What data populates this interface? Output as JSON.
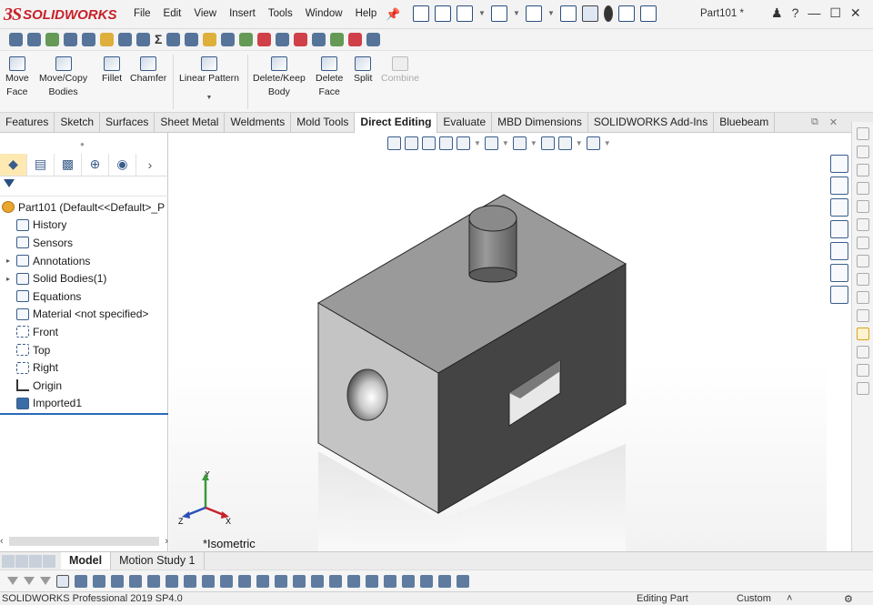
{
  "app": {
    "brand_ds": "3S",
    "brand_name": "SOLIDWORKS",
    "document_title": "Part101 *",
    "brand_color": "#c8202a"
  },
  "menu": [
    "File",
    "Edit",
    "View",
    "Insert",
    "Tools",
    "Window",
    "Help"
  ],
  "window_controls": [
    "person-icon",
    "help-icon",
    "minimize-icon",
    "maximize-icon",
    "close-icon"
  ],
  "command_manager": {
    "buttons": [
      {
        "label": "Move\nFace"
      },
      {
        "label": "Move/Copy\nBodies"
      },
      {
        "label": "Fillet"
      },
      {
        "label": "Chamfer"
      },
      {
        "label": "Linear Pattern"
      },
      {
        "label": "Delete/Keep\nBody"
      },
      {
        "label": "Delete\nFace"
      },
      {
        "label": "Split"
      },
      {
        "label": "Combine",
        "disabled": true
      }
    ]
  },
  "tabs": [
    "Features",
    "Sketch",
    "Surfaces",
    "Sheet Metal",
    "Weldments",
    "Mold Tools",
    "Direct Editing",
    "Evaluate",
    "MBD Dimensions",
    "SOLIDWORKS Add-Ins",
    "Bluebeam"
  ],
  "active_tab": "Direct Editing",
  "feature_tree": {
    "root": "Part101  (Default<<Default>_P",
    "items": [
      {
        "label": "History",
        "icon": "history-icon"
      },
      {
        "label": "Sensors",
        "icon": "sensors-icon"
      },
      {
        "label": "Annotations",
        "icon": "annotations-icon",
        "expandable": true
      },
      {
        "label": "Solid Bodies(1)",
        "icon": "solid-bodies-icon",
        "expandable": true
      },
      {
        "label": "Equations",
        "icon": "equations-icon"
      },
      {
        "label": "Material <not specified>",
        "icon": "material-icon"
      },
      {
        "label": "Front",
        "icon": "plane-icon"
      },
      {
        "label": "Top",
        "icon": "plane-icon"
      },
      {
        "label": "Right",
        "icon": "plane-icon"
      },
      {
        "label": "Origin",
        "icon": "origin-icon"
      },
      {
        "label": "Imported1",
        "icon": "imported-body-icon"
      }
    ]
  },
  "viewport": {
    "view_name": "*Isometric",
    "triad": {
      "x": "X",
      "y": "Y",
      "z": "Z"
    }
  },
  "model_tabs": [
    "Model",
    "Motion Study 1"
  ],
  "active_model_tab": "Model",
  "status": {
    "product": "SOLIDWORKS Professional 2019 SP4.0",
    "mode": "Editing Part",
    "units": "Custom",
    "units_dropdown": "˄"
  }
}
